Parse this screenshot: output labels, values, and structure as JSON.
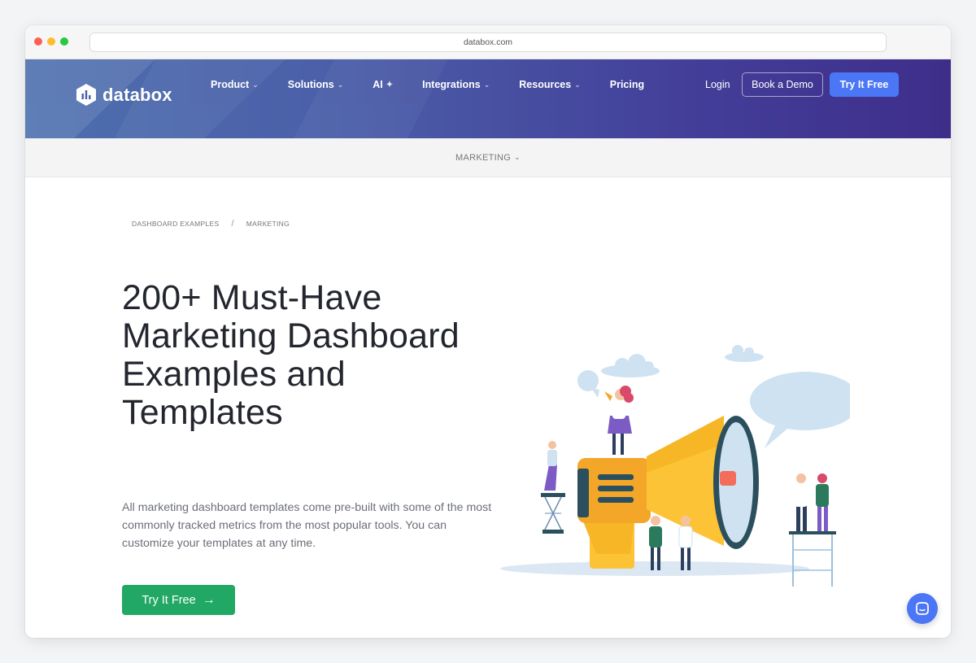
{
  "browser": {
    "url": "databox.com"
  },
  "nav": {
    "brand": "databox",
    "links": [
      {
        "label": "Product",
        "chevron": true
      },
      {
        "label": "Solutions",
        "chevron": true
      },
      {
        "label": "AI",
        "chevron": false,
        "icon": "sparkle-icon"
      },
      {
        "label": "Integrations",
        "chevron": true
      },
      {
        "label": "Resources",
        "chevron": true
      },
      {
        "label": "Pricing",
        "chevron": false
      }
    ],
    "login": "Login",
    "book_demo": "Book a Demo",
    "try_free": "Try It Free",
    "accent": "#4b76f6"
  },
  "subnav": {
    "category": "MARKETING"
  },
  "breadcrumb": {
    "items": [
      "DASHBOARD EXAMPLES",
      "MARKETING"
    ],
    "separator": "/"
  },
  "hero": {
    "title": "200+ Must-Have Marketing Dashboard Examples and Templates",
    "description": "All marketing dashboard templates come pre-built with some of the most commonly tracked metrics from the most popular tools. You can customize your templates at any time.",
    "cta": "Try It Free",
    "cta_color": "#21a865"
  },
  "illustration": {
    "subject": "megaphone-illustration"
  }
}
